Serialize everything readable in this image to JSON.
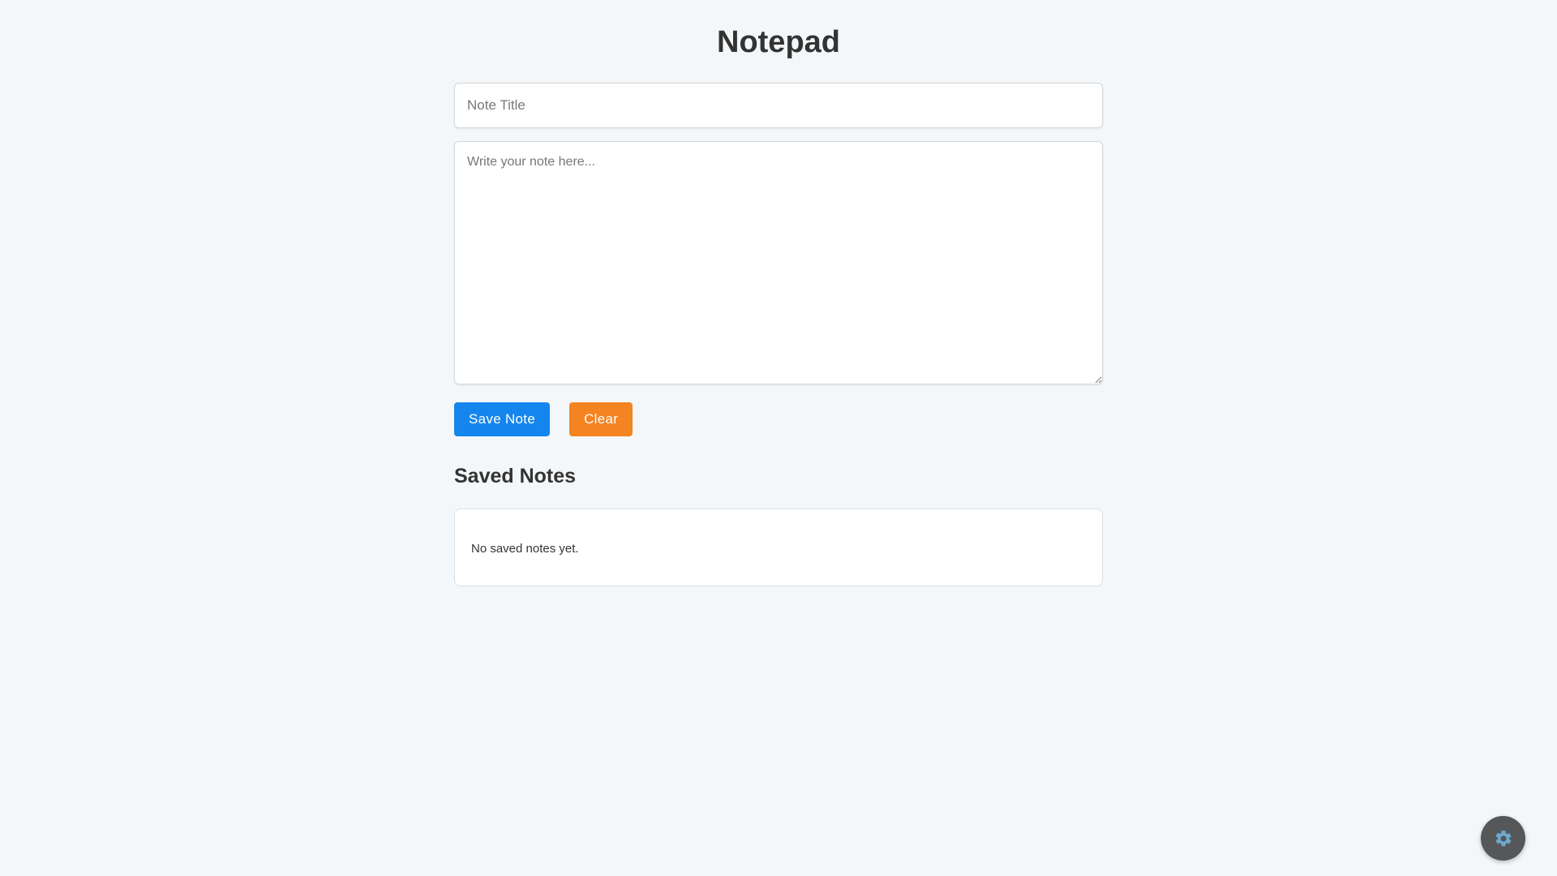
{
  "header": {
    "title": "Notepad"
  },
  "editor": {
    "title_placeholder": "Note Title",
    "title_value": "",
    "body_placeholder": "Write your note here...",
    "body_value": ""
  },
  "actions": {
    "save_label": "Save Note",
    "clear_label": "Clear"
  },
  "saved_notes": {
    "heading": "Saved Notes",
    "empty_message": "No saved notes yet.",
    "items": []
  },
  "settings": {
    "icon": "gear-icon"
  },
  "colors": {
    "background": "#f4f7f9",
    "save_button": "#1585ee",
    "clear_button": "#f48321",
    "settings_fab": "#555759",
    "gear": "#6fa8cf"
  }
}
